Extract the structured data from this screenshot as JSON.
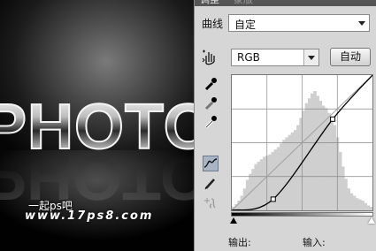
{
  "canvas": {
    "title_text": "PHOTO",
    "watermark_line1": "一起ps吧",
    "watermark_line2": "www.17ps8.com"
  },
  "panel": {
    "tabs": [
      "调整",
      "蒙版"
    ],
    "preset_label": "曲线",
    "preset_value": "自定",
    "channel_value": "RGB",
    "auto_button": "自动",
    "output_label": "输出:",
    "input_label": "输入:"
  },
  "curve": {
    "points": [
      [
        0,
        0
      ],
      [
        75,
        21
      ],
      [
        183,
        172
      ],
      [
        255,
        255
      ]
    ]
  },
  "histogram": {
    "values": [
      3,
      5,
      8,
      12,
      18,
      25,
      30,
      34,
      38,
      40,
      42,
      44,
      45,
      46,
      48,
      50,
      52,
      55,
      58,
      60,
      62,
      64,
      66,
      70,
      76,
      82,
      88,
      92,
      96,
      98,
      94,
      90,
      86,
      84,
      80,
      76,
      70,
      60,
      48,
      36,
      26,
      18,
      14,
      12,
      10,
      9,
      8,
      6,
      4,
      3
    ]
  },
  "colors": {
    "panel_bg": "#d6d6d6",
    "curve": "#000000",
    "histogram": "#cfcfcf"
  }
}
